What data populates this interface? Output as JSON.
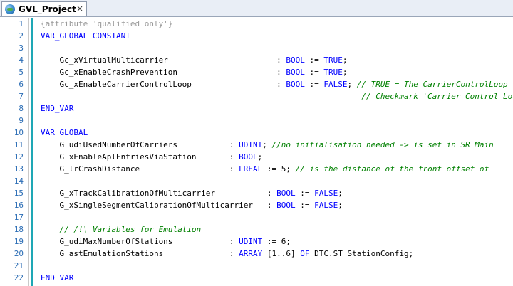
{
  "tab": {
    "title": "GVL_Project",
    "close": "×"
  },
  "lines": [
    {
      "n": "1",
      "tokens": [
        {
          "t": "attr",
          "v": "{attribute 'qualified_only'}"
        }
      ]
    },
    {
      "n": "2",
      "tokens": [
        {
          "t": "kw",
          "v": "VAR_GLOBAL CONSTANT"
        }
      ]
    },
    {
      "n": "3",
      "tokens": []
    },
    {
      "n": "4",
      "tokens": [
        {
          "t": "id",
          "v": "    Gc_xVirtualMulticarrier                       : "
        },
        {
          "t": "kw",
          "v": "BOOL"
        },
        {
          "t": "pun",
          "v": " := "
        },
        {
          "t": "kw",
          "v": "TRUE"
        },
        {
          "t": "pun",
          "v": ";"
        }
      ]
    },
    {
      "n": "5",
      "tokens": [
        {
          "t": "id",
          "v": "    Gc_xEnableCrashPrevention                     : "
        },
        {
          "t": "kw",
          "v": "BOOL"
        },
        {
          "t": "pun",
          "v": " := "
        },
        {
          "t": "kw",
          "v": "TRUE"
        },
        {
          "t": "pun",
          "v": ";"
        }
      ]
    },
    {
      "n": "6",
      "tokens": [
        {
          "t": "id",
          "v": "    Gc_xEnableCarrierControlLoop                  : "
        },
        {
          "t": "kw",
          "v": "BOOL"
        },
        {
          "t": "pun",
          "v": " := "
        },
        {
          "t": "kw",
          "v": "FALSE"
        },
        {
          "t": "pun",
          "v": "; "
        },
        {
          "t": "cmt",
          "v": "// TRUE = The CarrierControlLoop"
        }
      ]
    },
    {
      "n": "7",
      "tokens": [
        {
          "t": "id",
          "v": "                                                                    "
        },
        {
          "t": "cmt",
          "v": "// Checkmark 'Carrier Control Loo"
        }
      ]
    },
    {
      "n": "8",
      "tokens": [
        {
          "t": "kw",
          "v": "END_VAR"
        }
      ]
    },
    {
      "n": "9",
      "tokens": []
    },
    {
      "n": "10",
      "tokens": [
        {
          "t": "kw",
          "v": "VAR_GLOBAL"
        }
      ]
    },
    {
      "n": "11",
      "tokens": [
        {
          "t": "id",
          "v": "    G_udiUsedNumberOfCarriers           : "
        },
        {
          "t": "kw",
          "v": "UDINT"
        },
        {
          "t": "pun",
          "v": "; "
        },
        {
          "t": "cmt",
          "v": "//no initialisation needed -> is set in SR_Main"
        }
      ]
    },
    {
      "n": "12",
      "tokens": [
        {
          "t": "id",
          "v": "    G_xEnableAplEntriesViaStation       : "
        },
        {
          "t": "kw",
          "v": "BOOL"
        },
        {
          "t": "pun",
          "v": ";"
        }
      ]
    },
    {
      "n": "13",
      "tokens": [
        {
          "t": "id",
          "v": "    G_lrCrashDistance                   : "
        },
        {
          "t": "kw",
          "v": "LREAL"
        },
        {
          "t": "pun",
          "v": " := "
        },
        {
          "t": "num",
          "v": "5"
        },
        {
          "t": "pun",
          "v": "; "
        },
        {
          "t": "cmt",
          "v": "// is the distance of the front offset of"
        }
      ]
    },
    {
      "n": "14",
      "tokens": []
    },
    {
      "n": "15",
      "tokens": [
        {
          "t": "id",
          "v": "    G_xTrackCalibrationOfMulticarrier           : "
        },
        {
          "t": "kw",
          "v": "BOOL"
        },
        {
          "t": "pun",
          "v": " := "
        },
        {
          "t": "kw",
          "v": "FALSE"
        },
        {
          "t": "pun",
          "v": ";"
        }
      ]
    },
    {
      "n": "16",
      "tokens": [
        {
          "t": "id",
          "v": "    G_xSingleSegmentCalibrationOfMulticarrier   : "
        },
        {
          "t": "kw",
          "v": "BOOL"
        },
        {
          "t": "pun",
          "v": " := "
        },
        {
          "t": "kw",
          "v": "FALSE"
        },
        {
          "t": "pun",
          "v": ";"
        }
      ]
    },
    {
      "n": "17",
      "tokens": []
    },
    {
      "n": "18",
      "tokens": [
        {
          "t": "id",
          "v": "    "
        },
        {
          "t": "cmt",
          "v": "// /!\\ Variables for Emulation"
        }
      ]
    },
    {
      "n": "19",
      "tokens": [
        {
          "t": "id",
          "v": "    G_udiMaxNumberOfStations            : "
        },
        {
          "t": "kw",
          "v": "UDINT"
        },
        {
          "t": "pun",
          "v": " := "
        },
        {
          "t": "num",
          "v": "6"
        },
        {
          "t": "pun",
          "v": ";"
        }
      ]
    },
    {
      "n": "20",
      "tokens": [
        {
          "t": "id",
          "v": "    G_astEmulationStations              : "
        },
        {
          "t": "kw",
          "v": "ARRAY"
        },
        {
          "t": "pun",
          "v": " ["
        },
        {
          "t": "num",
          "v": "1..6"
        },
        {
          "t": "pun",
          "v": "] "
        },
        {
          "t": "kw",
          "v": "OF"
        },
        {
          "t": "id",
          "v": " DTC.ST_StationConfig;"
        }
      ]
    },
    {
      "n": "21",
      "tokens": []
    },
    {
      "n": "22",
      "tokens": [
        {
          "t": "kw",
          "v": "END_VAR"
        }
      ]
    }
  ],
  "colors": {
    "keyword": "#0000ff",
    "comment": "#008000",
    "attribute": "#999999",
    "line_number": "#2b6db5",
    "gutter_bar": "#1ea7b5"
  },
  "icons": {
    "tab": "globe-icon"
  }
}
